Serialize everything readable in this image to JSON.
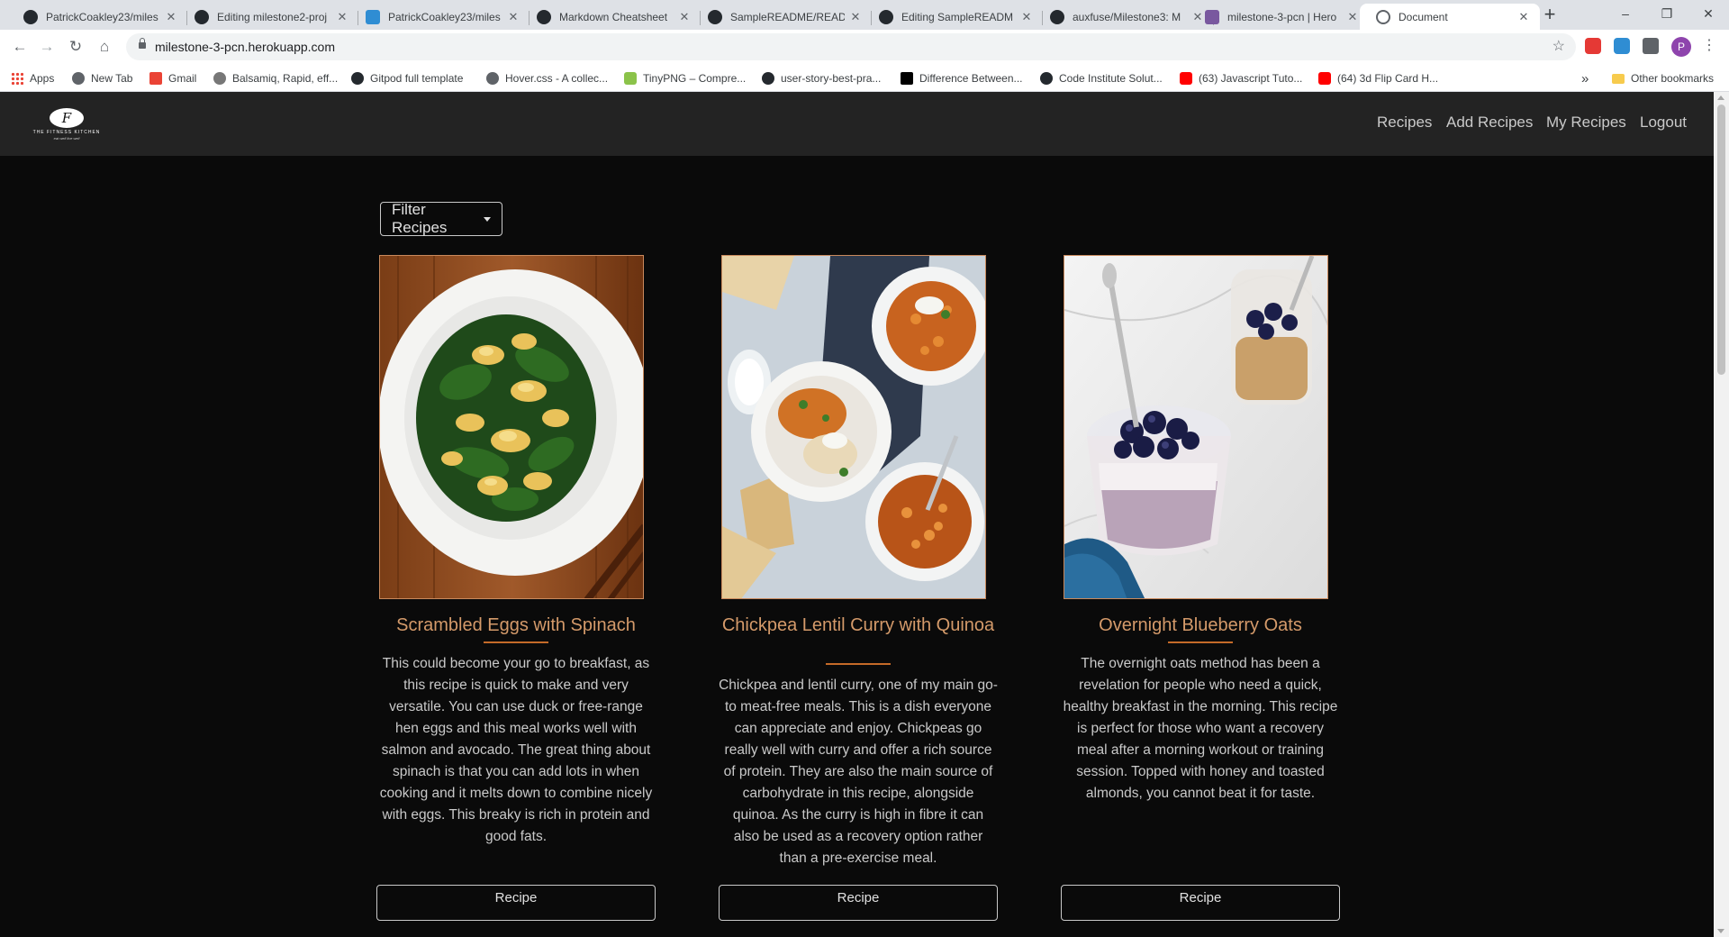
{
  "browser": {
    "tabs": [
      {
        "title": "PatrickCoakley23/miles",
        "icon": "github-icon"
      },
      {
        "title": "Editing milestone2-proj",
        "icon": "github-icon"
      },
      {
        "title": "PatrickCoakley23/miles",
        "icon": "cube-icon"
      },
      {
        "title": "Markdown Cheatsheet",
        "icon": "github-icon"
      },
      {
        "title": "SampleREADME/READM",
        "icon": "github-icon"
      },
      {
        "title": "Editing SampleREADM",
        "icon": "github-icon"
      },
      {
        "title": "auxfuse/Milestone3: M",
        "icon": "github-icon"
      },
      {
        "title": "milestone-3-pcn | Hero",
        "icon": "heroku-icon"
      },
      {
        "title": "Document",
        "icon": "globe-icon"
      }
    ],
    "new_tab": "+",
    "window_controls": {
      "minimize": "–",
      "restore": "❐",
      "close": "✕"
    },
    "url": "milestone-3-pcn.herokuapp.com",
    "nav": {
      "back": "←",
      "forward": "→",
      "reload": "↻",
      "home": "⌂",
      "star": "☆"
    },
    "profile_initial": "P",
    "bookmarks": [
      "Apps",
      "New Tab",
      "Gmail",
      "Balsamiq, Rapid, eff...",
      "Gitpod full template",
      "Hover.css - A collec...",
      "TinyPNG – Compre...",
      "user-story-best-pra...",
      "Difference Between...",
      "Code Institute Solut...",
      "(63) Javascript Tuto...",
      "(64) 3d Flip Card H..."
    ],
    "bookmarks_overflow": "»",
    "other_bookmarks": "Other bookmarks"
  },
  "site": {
    "logo_mark": "F",
    "logo_text": "THE FITNESS KITCHEN",
    "logo_tagline": "eat well live well",
    "nav": [
      "Recipes",
      "Add Recipes",
      "My Recipes",
      "Logout"
    ],
    "filter_label": "Filter Recipes",
    "cards": [
      {
        "title": "Scrambled Eggs with Spinach",
        "description": "This could become your go to breakfast, as this recipe is quick to make and very versatile. You can use duck or free-range hen eggs and this meal works well with salmon and avocado. The great thing about spinach is that you can add lots in when cooking and it melts down to combine nicely with eggs. This breaky is rich in protein and good fats.",
        "button": "Recipe"
      },
      {
        "title": "Chickpea Lentil Curry with Quinoa",
        "description": "Chickpea and lentil curry, one of my main go-to meat-free meals. This is a dish everyone can appreciate and enjoy. Chickpeas go really well with curry and offer a rich source of protein. They are also the main source of carbohydrate in this recipe, alongside quinoa. As the curry is high in fibre it can also be used as a recovery option rather than a pre-exercise meal.",
        "button": "Recipe"
      },
      {
        "title": "Overnight Blueberry Oats",
        "description": "The overnight oats method has been a revelation for people who need a quick, healthy breakfast in the morning. This recipe is perfect for those who want a recovery meal after a morning workout or training session. Topped with honey and toasted almonds, you cannot beat it for taste.",
        "button": "Recipe"
      }
    ]
  },
  "colors": {
    "page_bg": "#0a0a0a",
    "nav_bg": "#232323",
    "accent_title": "#d49a6a",
    "accent_underline": "#c46a28"
  }
}
